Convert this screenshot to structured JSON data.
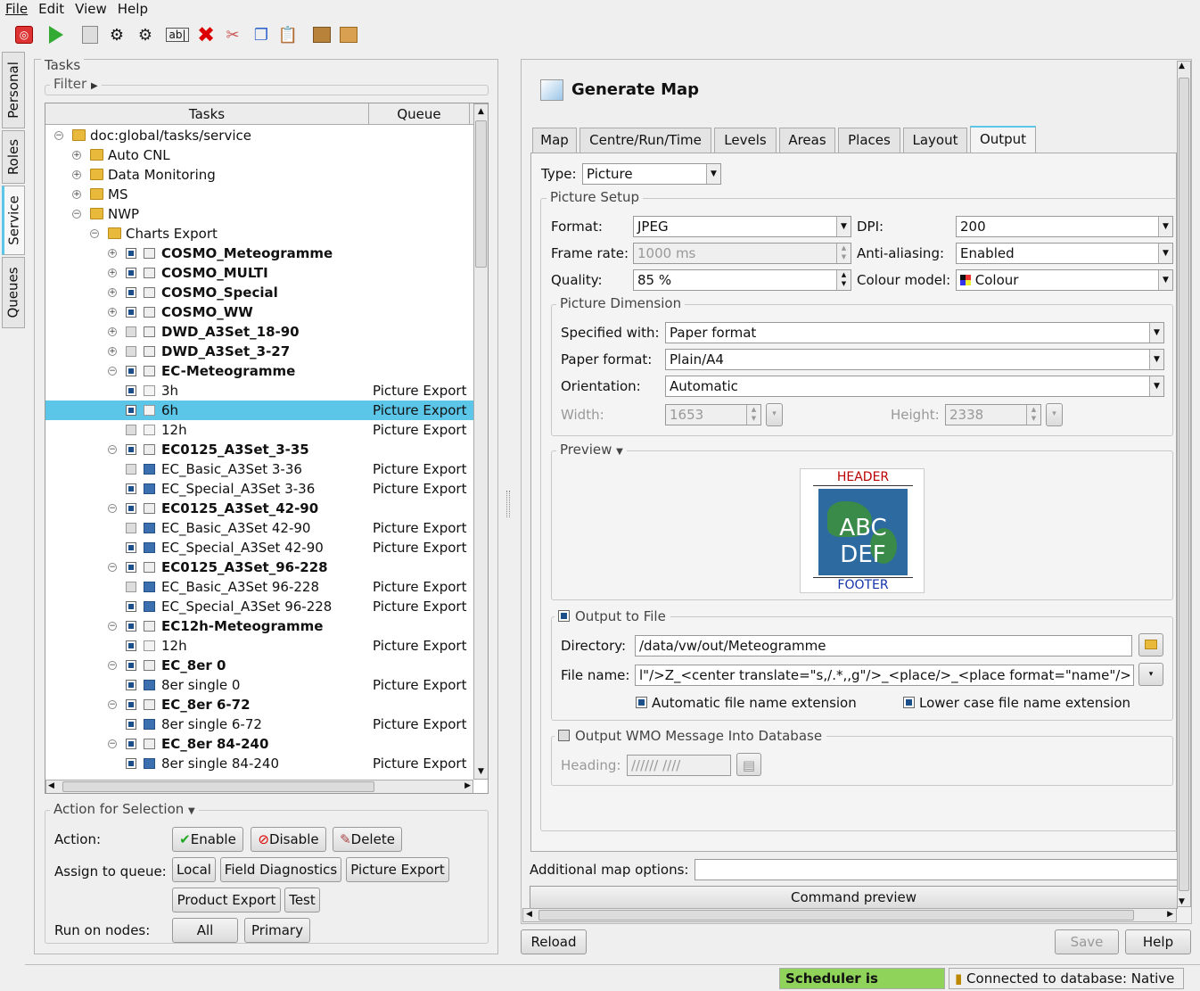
{
  "menu": [
    "File",
    "Edit",
    "View",
    "Help"
  ],
  "toolbar_icons": [
    "stop-icon",
    "run-icon",
    "properties-icon",
    "settings-icon",
    "add-task-icon",
    "rename-icon",
    "delete-icon",
    "cut-icon",
    "copy-icon",
    "paste-icon",
    "export-icon",
    "import-icon"
  ],
  "sidetabs": [
    "Personal",
    "Roles",
    "Service",
    "Queues"
  ],
  "tasks": {
    "title": "Tasks",
    "filter": "Filter",
    "col_tasks": "Tasks",
    "col_queue": "Queue",
    "rows": [
      {
        "level": 0,
        "type": "folder",
        "label": "doc:global/tasks/service",
        "exp": "-"
      },
      {
        "level": 1,
        "type": "folder",
        "label": "Auto CNL",
        "exp": "+"
      },
      {
        "level": 1,
        "type": "folder",
        "label": "Data Monitoring",
        "exp": "+"
      },
      {
        "level": 1,
        "type": "folder",
        "label": "MS",
        "exp": "+"
      },
      {
        "level": 1,
        "type": "folder",
        "label": "NWP",
        "exp": "-"
      },
      {
        "level": 2,
        "type": "folder",
        "label": "Charts Export",
        "exp": "-"
      },
      {
        "level": 3,
        "type": "group",
        "label": "COSMO_Meteogramme",
        "exp": "+",
        "chk": "on"
      },
      {
        "level": 3,
        "type": "group",
        "label": "COSMO_MULTI",
        "exp": "+",
        "chk": "on"
      },
      {
        "level": 3,
        "type": "group",
        "label": "COSMO_Special",
        "exp": "+",
        "chk": "on"
      },
      {
        "level": 3,
        "type": "group",
        "label": "COSMO_WW",
        "exp": "+",
        "chk": "on"
      },
      {
        "level": 3,
        "type": "group",
        "label": "DWD_A3Set_18-90",
        "exp": "+",
        "chk": "off"
      },
      {
        "level": 3,
        "type": "group",
        "label": "DWD_A3Set_3-27",
        "exp": "+",
        "chk": "off"
      },
      {
        "level": 3,
        "type": "group",
        "label": "EC-Meteogramme",
        "exp": "-",
        "chk": "on"
      },
      {
        "level": 4,
        "type": "pic",
        "label": "3h",
        "chk": "on",
        "queue": "Picture Export"
      },
      {
        "level": 4,
        "type": "pic",
        "label": "6h",
        "chk": "on",
        "queue": "Picture Export",
        "sel": true
      },
      {
        "level": 4,
        "type": "pic",
        "label": "12h",
        "chk": "off",
        "queue": "Picture Export"
      },
      {
        "level": 3,
        "type": "group",
        "label": "EC0125_A3Set_3-35",
        "exp": "-",
        "chk": "on"
      },
      {
        "level": 4,
        "type": "tbl",
        "label": "EC_Basic_A3Set 3-36",
        "chk": "off",
        "queue": "Picture Export"
      },
      {
        "level": 4,
        "type": "tbl",
        "label": "EC_Special_A3Set 3-36",
        "chk": "on",
        "queue": "Picture Export"
      },
      {
        "level": 3,
        "type": "group",
        "label": "EC0125_A3Set_42-90",
        "exp": "-",
        "chk": "on"
      },
      {
        "level": 4,
        "type": "tbl",
        "label": "EC_Basic_A3Set 42-90",
        "chk": "off",
        "queue": "Picture Export"
      },
      {
        "level": 4,
        "type": "tbl",
        "label": "EC_Special_A3Set 42-90",
        "chk": "on",
        "queue": "Picture Export"
      },
      {
        "level": 3,
        "type": "group",
        "label": "EC0125_A3Set_96-228",
        "exp": "-",
        "chk": "on"
      },
      {
        "level": 4,
        "type": "tbl",
        "label": "EC_Basic_A3Set 96-228",
        "chk": "off",
        "queue": "Picture Export"
      },
      {
        "level": 4,
        "type": "tbl",
        "label": "EC_Special_A3Set 96-228",
        "chk": "on",
        "queue": "Picture Export"
      },
      {
        "level": 3,
        "type": "group",
        "label": "EC12h-Meteogramme",
        "exp": "-",
        "chk": "on"
      },
      {
        "level": 4,
        "type": "pic",
        "label": "12h",
        "chk": "on",
        "queue": "Picture Export"
      },
      {
        "level": 3,
        "type": "group",
        "label": "EC_8er 0",
        "exp": "-",
        "chk": "on"
      },
      {
        "level": 4,
        "type": "tbl",
        "label": "8er single 0",
        "chk": "on",
        "queue": "Picture Export"
      },
      {
        "level": 3,
        "type": "group",
        "label": "EC_8er 6-72",
        "exp": "-",
        "chk": "on"
      },
      {
        "level": 4,
        "type": "tbl",
        "label": "8er single 6-72",
        "chk": "on",
        "queue": "Picture Export"
      },
      {
        "level": 3,
        "type": "group",
        "label": "EC_8er 84-240",
        "exp": "-",
        "chk": "on"
      },
      {
        "level": 4,
        "type": "tbl",
        "label": "8er single 84-240",
        "chk": "on",
        "queue": "Picture Export"
      }
    ]
  },
  "action": {
    "title": "Action for Selection",
    "action_label": "Action:",
    "enable": "Enable",
    "disable": "Disable",
    "delete": "Delete",
    "assign_label": "Assign to queue:",
    "queues": [
      "Local",
      "Field Diagnostics",
      "Picture Export",
      "Product Export",
      "Test"
    ],
    "nodes_label": "Run on nodes:",
    "all": "All",
    "primary": "Primary"
  },
  "right": {
    "title": "Generate Map",
    "tabs": [
      "Map",
      "Centre/Run/Time",
      "Levels",
      "Areas",
      "Places",
      "Layout",
      "Output"
    ],
    "type_label": "Type:",
    "type_value": "Picture",
    "picture_setup": "Picture Setup",
    "format_label": "Format:",
    "format_value": "JPEG",
    "dpi_label": "DPI:",
    "dpi_value": "200",
    "framerate_label": "Frame rate:",
    "framerate_value": "1000 ms",
    "aa_label": "Anti-aliasing:",
    "aa_value": "Enabled",
    "quality_label": "Quality:",
    "quality_value": "85 %",
    "colour_label": "Colour model:",
    "colour_value": "Colour",
    "dimension": "Picture Dimension",
    "spec_label": "Specified with:",
    "spec_value": "Paper format",
    "paper_label": "Paper format:",
    "paper_value": "Plain/A4",
    "orient_label": "Orientation:",
    "orient_value": "Automatic",
    "width_label": "Width:",
    "width_value": "1653",
    "height_label": "Height:",
    "height_value": "2338",
    "preview": "Preview",
    "preview_header": "HEADER",
    "preview_footer": "FOOTER",
    "preview_abc": "ABC",
    "preview_def": "DEF",
    "output_file": "Output to File",
    "dir_label": "Directory:",
    "dir_value": "/data/vw/out/Meteogramme",
    "fname_label": "File name:",
    "fname_value": "l\"/>Z_<center translate=\"s,/.*,,g\"/>_<place/>_<place format=\"name\"/>",
    "auto_ext": "Automatic file name extension",
    "lower_ext": "Lower case file name extension",
    "wmo": "Output WMO Message Into Database",
    "heading_label": "Heading:",
    "heading_placeholder": "////// ////",
    "additional_label": "Additional map options:",
    "command_preview": "Command preview"
  },
  "buttons": {
    "reload": "Reload",
    "save": "Save",
    "help": "Help"
  },
  "status": {
    "scheduler": "Scheduler is running",
    "db": "Connected to database: Native"
  }
}
